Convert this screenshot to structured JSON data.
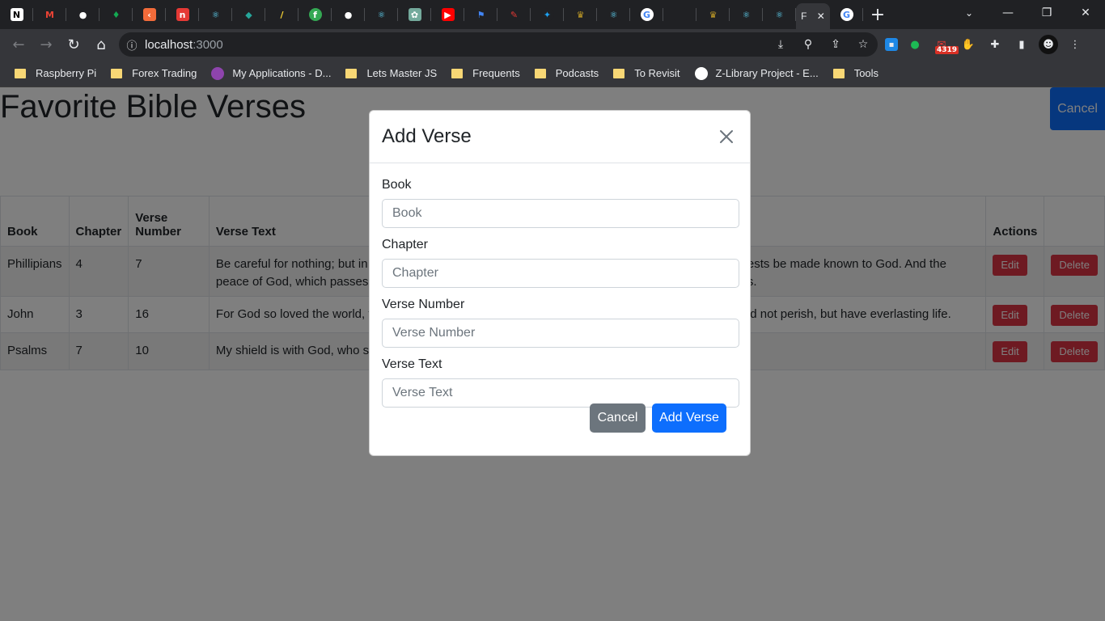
{
  "browser": {
    "tab_favicons": [
      {
        "name": "notion-tab",
        "glyph": "N",
        "bg": "#ffffff",
        "fg": "#000000"
      },
      {
        "name": "gmail-tab",
        "glyph": "M",
        "bg": "#202124",
        "fg": "#ea4335"
      },
      {
        "name": "github-tab",
        "glyph": "●",
        "bg": "#202124",
        "fg": "#ffffff"
      },
      {
        "name": "mongodb-tab",
        "glyph": "♦",
        "bg": "#202124",
        "fg": "#13aa52"
      },
      {
        "name": "app-tab",
        "glyph": "‹",
        "bg": "#f26b3a",
        "fg": "#ffffff"
      },
      {
        "name": "news-tab",
        "glyph": "n",
        "bg": "#e53935",
        "fg": "#ffffff"
      },
      {
        "name": "react-tab",
        "glyph": "⚛",
        "bg": "#202124",
        "fg": "#61dafb"
      },
      {
        "name": "diamond-tab",
        "glyph": "◆",
        "bg": "#202124",
        "fg": "#26a69a"
      },
      {
        "name": "slash-tab",
        "glyph": "/",
        "bg": "#202124",
        "fg": "#fdd835"
      },
      {
        "name": "fh-tab",
        "glyph": "f",
        "bg": "#34a853",
        "fg": "#ffffff"
      },
      {
        "name": "github-tab-2",
        "glyph": "●",
        "bg": "#202124",
        "fg": "#ffffff"
      },
      {
        "name": "react-tab-2",
        "glyph": "⚛",
        "bg": "#202124",
        "fg": "#61dafb"
      },
      {
        "name": "chatgpt-tab",
        "glyph": "✿",
        "bg": "#74aa9c",
        "fg": "#ffffff"
      },
      {
        "name": "youtube-tab",
        "glyph": "▶",
        "bg": "#ff0000",
        "fg": "#ffffff"
      },
      {
        "name": "flag-tab",
        "glyph": "⚑",
        "bg": "#202124",
        "fg": "#4285f4"
      },
      {
        "name": "pin-tab",
        "glyph": "✎",
        "bg": "#202124",
        "fg": "#e53935"
      },
      {
        "name": "twitter-tab",
        "glyph": "✦",
        "bg": "#202124",
        "fg": "#1da1f2"
      },
      {
        "name": "crown-tab",
        "glyph": "♛",
        "bg": "#202124",
        "fg": "#c9a227"
      },
      {
        "name": "react-tab-3",
        "glyph": "⚛",
        "bg": "#202124",
        "fg": "#61dafb"
      },
      {
        "name": "google-tab",
        "glyph": "G",
        "bg": "#ffffff",
        "fg": "#4285f4"
      },
      {
        "name": "blank-tab",
        "glyph": "",
        "bg": "#202124",
        "fg": "#202124"
      },
      {
        "name": "crown-tab-2",
        "glyph": "♛",
        "bg": "#202124",
        "fg": "#c9a227"
      },
      {
        "name": "react-tab-4",
        "glyph": "⚛",
        "bg": "#202124",
        "fg": "#61dafb"
      },
      {
        "name": "react-tab-5",
        "glyph": "⚛",
        "bg": "#202124",
        "fg": "#61dafb"
      }
    ],
    "active_tab_label": "F",
    "url_host": "localhost",
    "url_port": ":3000",
    "extension_badge": "4319",
    "bookmarks": [
      {
        "label": "Raspberry Pi",
        "kind": "folder"
      },
      {
        "label": "Forex Trading",
        "kind": "folder"
      },
      {
        "label": "My Applications - D...",
        "kind": "site",
        "color": "#8e44ad"
      },
      {
        "label": "Lets Master JS",
        "kind": "folder"
      },
      {
        "label": "Frequents",
        "kind": "folder"
      },
      {
        "label": "Podcasts",
        "kind": "folder"
      },
      {
        "label": "To Revisit",
        "kind": "folder"
      },
      {
        "label": "Z-Library Project - E...",
        "kind": "site",
        "color": "#ffffff"
      },
      {
        "label": "Tools",
        "kind": "folder"
      }
    ]
  },
  "page": {
    "title": "Favorite Bible Verses",
    "top_cancel_label": "Cancel",
    "table": {
      "headers": {
        "book": "Book",
        "chapter": "Chapter",
        "verse_number": "Verse Number",
        "verse_text": "Verse Text",
        "actions": "Actions"
      },
      "rows": [
        {
          "book": "Phillipians",
          "chapter": "4",
          "verse": "7",
          "text_left": "Be careful for nothing; but in",
          "text_left_2": "peace of God, which passes a",
          "text_right": "ests be made known to God. And the",
          "text_right_2": "s."
        },
        {
          "book": "John",
          "chapter": "3",
          "verse": "16",
          "text_left": "For God so loved the world, t",
          "text_left_2": "",
          "text_right": "ld not perish, but have everlasting life.",
          "text_right_2": ""
        },
        {
          "book": "Psalms",
          "chapter": "7",
          "verse": "10",
          "text_left": "My shield is with God, who sa",
          "text_left_2": "",
          "text_right": "",
          "text_right_2": ""
        }
      ],
      "edit_label": "Edit",
      "delete_label": "Delete"
    }
  },
  "modal": {
    "title": "Add Verse",
    "fields": [
      {
        "label": "Book",
        "placeholder": "Book",
        "value": ""
      },
      {
        "label": "Chapter",
        "placeholder": "Chapter",
        "value": ""
      },
      {
        "label": "Verse Number",
        "placeholder": "Verse Number",
        "value": ""
      },
      {
        "label": "Verse Text",
        "placeholder": "Verse Text",
        "value": ""
      }
    ],
    "cancel_label": "Cancel",
    "submit_label": "Add Verse"
  },
  "colors": {
    "primary": "#0d6efd",
    "secondary": "#6c757d",
    "danger": "#dc3545",
    "backdrop": "rgba(0,0,0,0.5)"
  }
}
